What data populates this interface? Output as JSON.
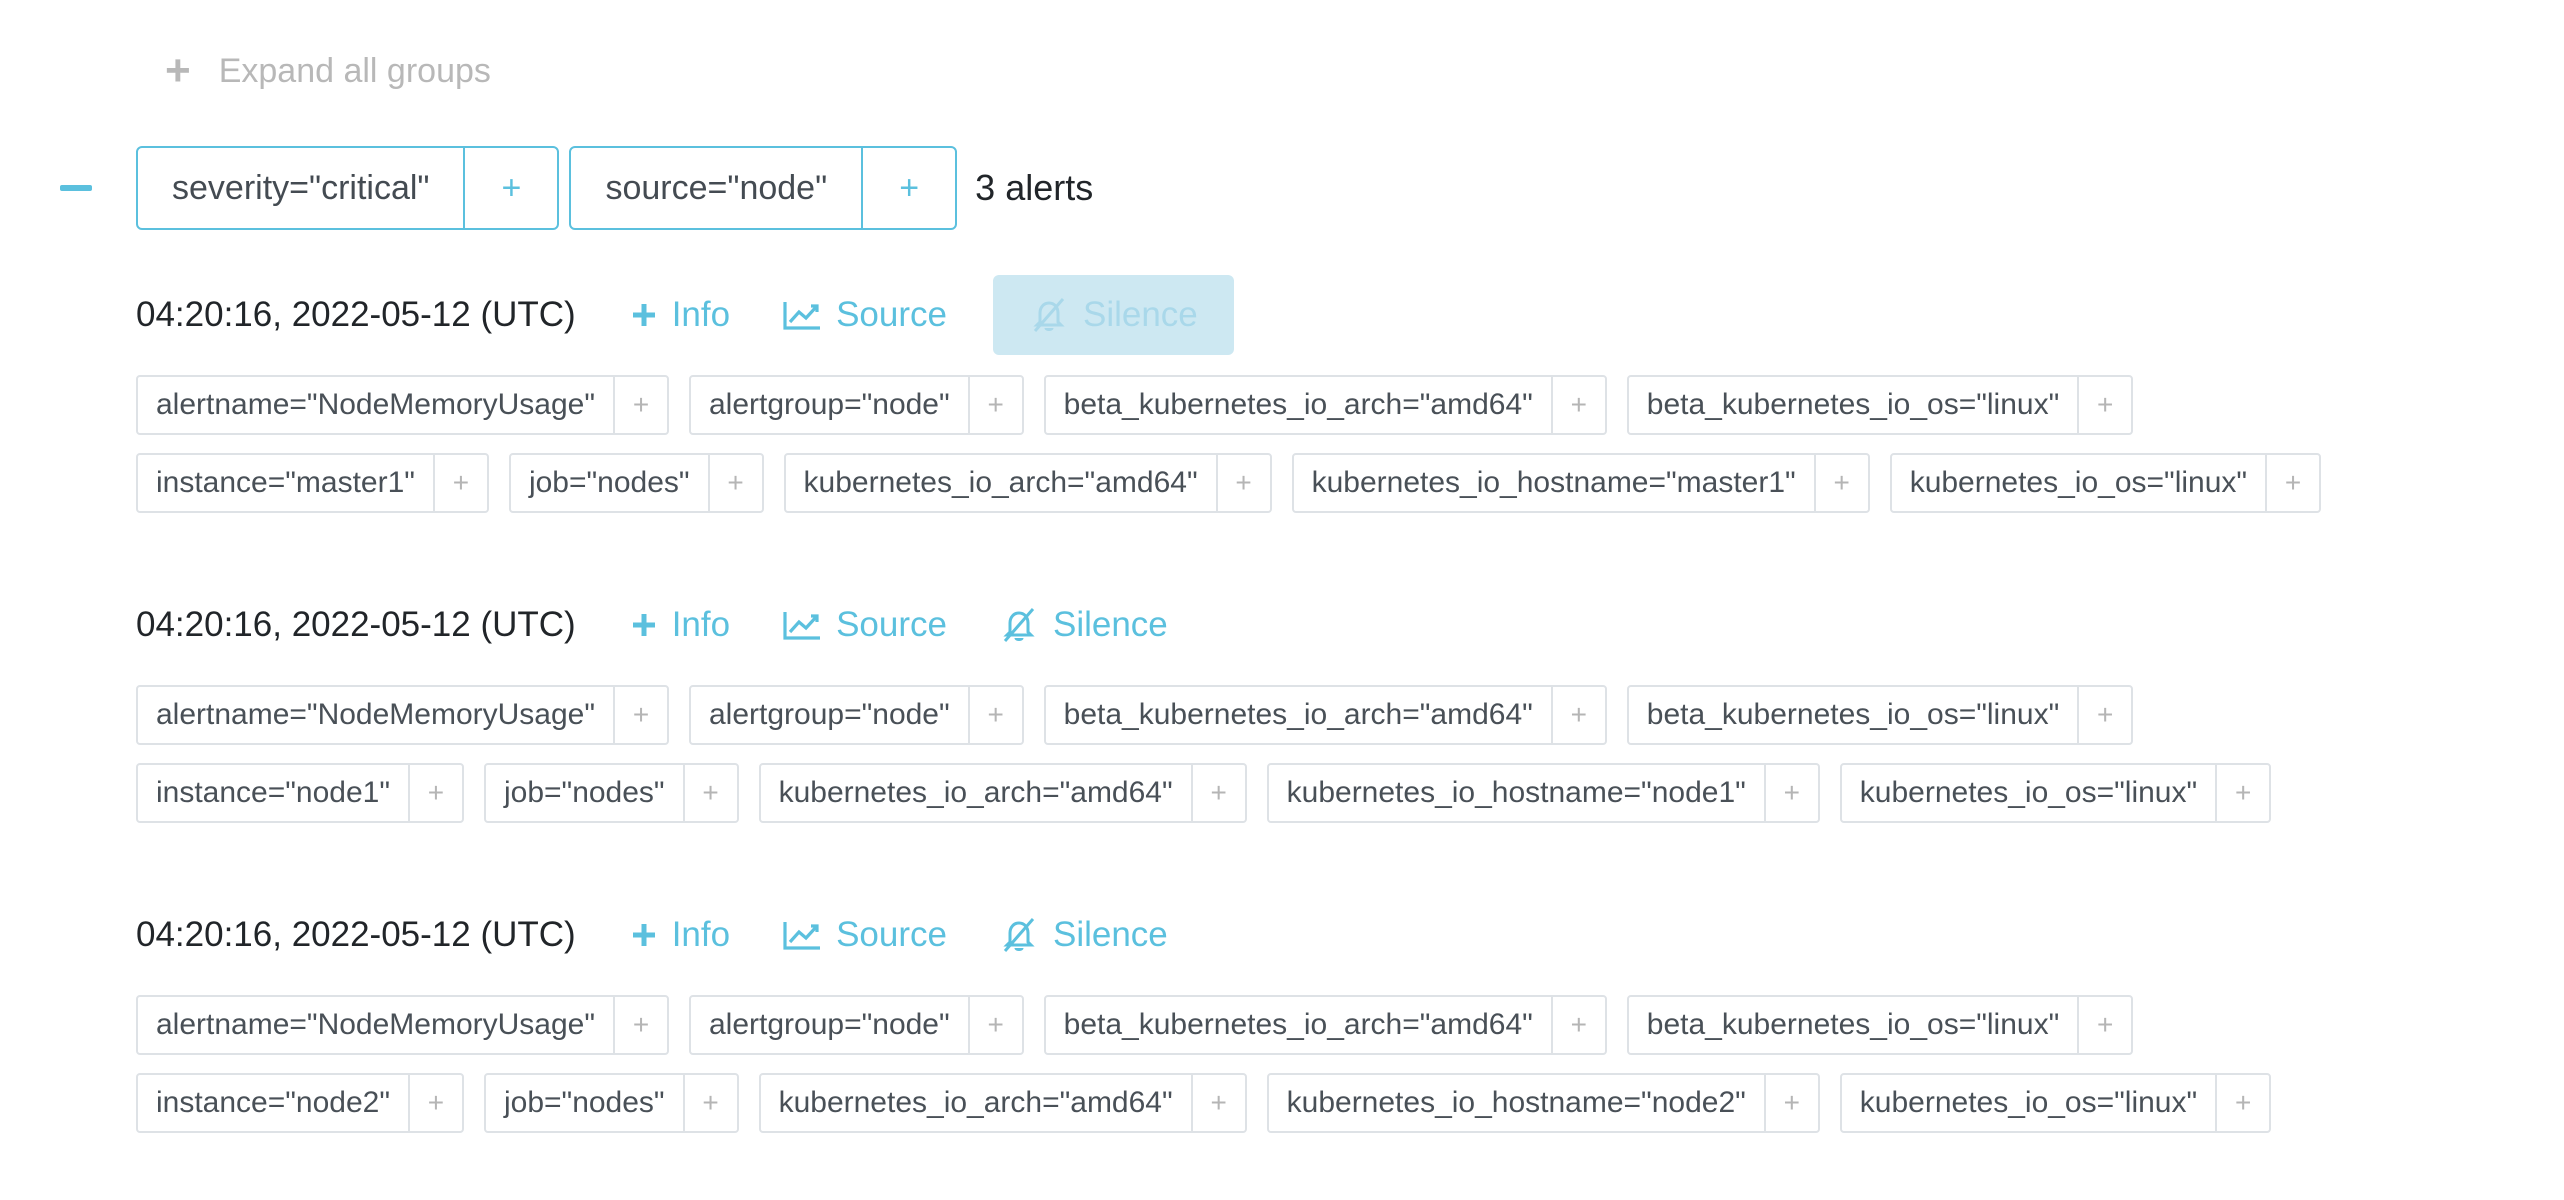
{
  "expand_all": {
    "label": "Expand all groups"
  },
  "group": {
    "chips": [
      {
        "label": "severity=\"critical\"",
        "plus": "+"
      },
      {
        "label": "source=\"node\"",
        "plus": "+"
      }
    ],
    "count": "3 alerts"
  },
  "actions": {
    "info": "Info",
    "source": "Source",
    "silence": "Silence"
  },
  "alerts": [
    {
      "time": "04:20:16, 2022-05-12 (UTC)",
      "silence_active": true,
      "rows": [
        [
          "alertname=\"NodeMemoryUsage\"",
          "alertgroup=\"node\"",
          "beta_kubernetes_io_arch=\"amd64\"",
          "beta_kubernetes_io_os=\"linux\""
        ],
        [
          "instance=\"master1\"",
          "job=\"nodes\"",
          "kubernetes_io_arch=\"amd64\"",
          "kubernetes_io_hostname=\"master1\"",
          "kubernetes_io_os=\"linux\""
        ]
      ]
    },
    {
      "time": "04:20:16, 2022-05-12 (UTC)",
      "silence_active": false,
      "rows": [
        [
          "alertname=\"NodeMemoryUsage\"",
          "alertgroup=\"node\"",
          "beta_kubernetes_io_arch=\"amd64\"",
          "beta_kubernetes_io_os=\"linux\""
        ],
        [
          "instance=\"node1\"",
          "job=\"nodes\"",
          "kubernetes_io_arch=\"amd64\"",
          "kubernetes_io_hostname=\"node1\"",
          "kubernetes_io_os=\"linux\""
        ]
      ]
    },
    {
      "time": "04:20:16, 2022-05-12 (UTC)",
      "silence_active": false,
      "rows": [
        [
          "alertname=\"NodeMemoryUsage\"",
          "alertgroup=\"node\"",
          "beta_kubernetes_io_arch=\"amd64\"",
          "beta_kubernetes_io_os=\"linux\""
        ],
        [
          "instance=\"node2\"",
          "job=\"nodes\"",
          "kubernetes_io_arch=\"amd64\"",
          "kubernetes_io_hostname=\"node2\"",
          "kubernetes_io_os=\"linux\""
        ]
      ]
    }
  ],
  "colors": {
    "accent": "#5bc0de",
    "muted": "#b8b8b8",
    "border": "#dee2e6",
    "silence_bg": "#cde8f2"
  },
  "icons": {
    "info": "plus-icon",
    "source": "chart-line-icon",
    "silence": "bell-slash-icon",
    "expand": "plus-icon",
    "collapse": "minus-icon"
  }
}
